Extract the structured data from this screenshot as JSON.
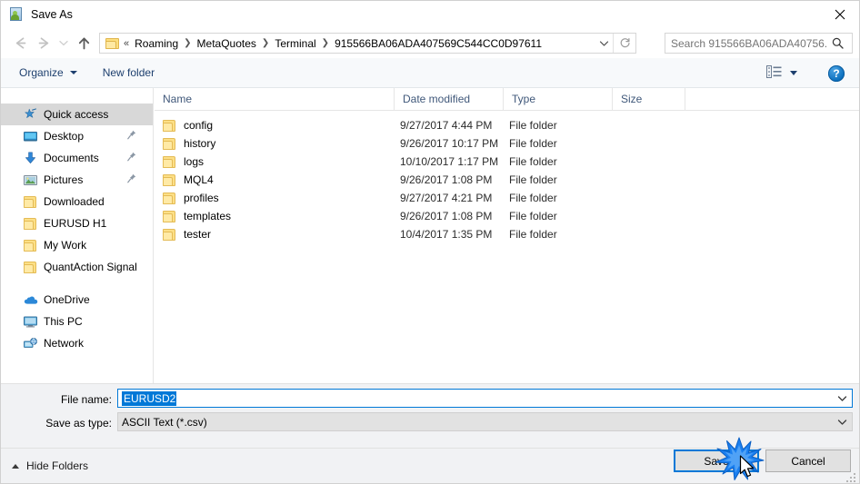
{
  "window": {
    "title": "Save As",
    "icon": "save-as-app-icon",
    "close_label": "✕"
  },
  "nav": {
    "back_icon": "back-arrow-icon",
    "forward_icon": "forward-arrow-icon",
    "recent_icon": "recent-locations-chevron-icon",
    "up_icon": "up-arrow-icon",
    "folder_icon": "folder-icon",
    "breadcrumbs": [
      {
        "label": "«",
        "type": "overflow"
      },
      {
        "label": "Roaming",
        "type": "crumb"
      },
      {
        "label": "MetaQuotes",
        "type": "crumb"
      },
      {
        "label": "Terminal",
        "type": "crumb"
      },
      {
        "label": "915566BA06ADA407569C544CC0D97611",
        "type": "crumb"
      }
    ],
    "dropdown_icon": "chevron-down-icon",
    "refresh_icon": "refresh-icon"
  },
  "search": {
    "placeholder": "Search 915566BA06ADA40756...",
    "value": "",
    "icon": "search-icon"
  },
  "toolbar": {
    "organize_label": "Organize",
    "new_folder_label": "New folder",
    "view_icon": "view-list-icon",
    "help_label": "?",
    "help_icon": "help-icon"
  },
  "sidebar": {
    "items": [
      {
        "label": "Quick access",
        "icon": "star-pin-icon",
        "selected": true,
        "pinned": false
      },
      {
        "label": "Desktop",
        "icon": "desktop-icon",
        "selected": false,
        "pinned": true
      },
      {
        "label": "Documents",
        "icon": "documents-download-icon",
        "selected": false,
        "pinned": true
      },
      {
        "label": "Pictures",
        "icon": "pictures-icon",
        "selected": false,
        "pinned": true
      },
      {
        "label": "Downloaded",
        "icon": "folder-icon",
        "selected": false,
        "pinned": false
      },
      {
        "label": "EURUSD H1",
        "icon": "folder-icon",
        "selected": false,
        "pinned": false
      },
      {
        "label": "My Work",
        "icon": "folder-icon",
        "selected": false,
        "pinned": false
      },
      {
        "label": "QuantAction Signal",
        "icon": "folder-icon",
        "selected": false,
        "pinned": false
      },
      {
        "label": "OneDrive",
        "icon": "onedrive-cloud-icon",
        "selected": false,
        "pinned": false
      },
      {
        "label": "This PC",
        "icon": "this-pc-icon",
        "selected": false,
        "pinned": false
      },
      {
        "label": "Network",
        "icon": "network-icon",
        "selected": false,
        "pinned": false
      }
    ]
  },
  "filelist": {
    "columns": [
      {
        "label": "Name",
        "sorted": "asc"
      },
      {
        "label": "Date modified",
        "sorted": ""
      },
      {
        "label": "Type",
        "sorted": ""
      },
      {
        "label": "Size",
        "sorted": ""
      }
    ],
    "rows": [
      {
        "name": "config",
        "date": "9/27/2017 4:44 PM",
        "type": "File folder",
        "size": "",
        "icon": "folder-icon"
      },
      {
        "name": "history",
        "date": "9/26/2017 10:17 PM",
        "type": "File folder",
        "size": "",
        "icon": "folder-icon"
      },
      {
        "name": "logs",
        "date": "10/10/2017 1:17 PM",
        "type": "File folder",
        "size": "",
        "icon": "folder-icon"
      },
      {
        "name": "MQL4",
        "date": "9/26/2017 1:08 PM",
        "type": "File folder",
        "size": "",
        "icon": "folder-icon"
      },
      {
        "name": "profiles",
        "date": "9/27/2017 4:21 PM",
        "type": "File folder",
        "size": "",
        "icon": "folder-icon"
      },
      {
        "name": "templates",
        "date": "9/26/2017 1:08 PM",
        "type": "File folder",
        "size": "",
        "icon": "folder-icon"
      },
      {
        "name": "tester",
        "date": "10/4/2017 1:35 PM",
        "type": "File folder",
        "size": "",
        "icon": "folder-icon"
      }
    ]
  },
  "form": {
    "filename_label": "File name:",
    "filename_value": "EURUSD2",
    "savetype_label": "Save as type:",
    "savetype_value": "ASCII Text (*.csv)",
    "chevron_icon": "chevron-down-icon"
  },
  "footer": {
    "hide_folders_label": "Hide Folders",
    "save_label": "Save",
    "cancel_label": "Cancel",
    "resize_grip_icon": "resize-grip-icon"
  },
  "pointer": {
    "cursor_icon": "arrow-cursor-icon",
    "click_effect_icon": "click-burst-icon"
  },
  "colors": {
    "accent": "#0078d7",
    "folder": "#fcdf86",
    "toolbar_text": "#1d3f6e",
    "selection": "#d8d8d8",
    "panel": "#f1f2f4"
  }
}
